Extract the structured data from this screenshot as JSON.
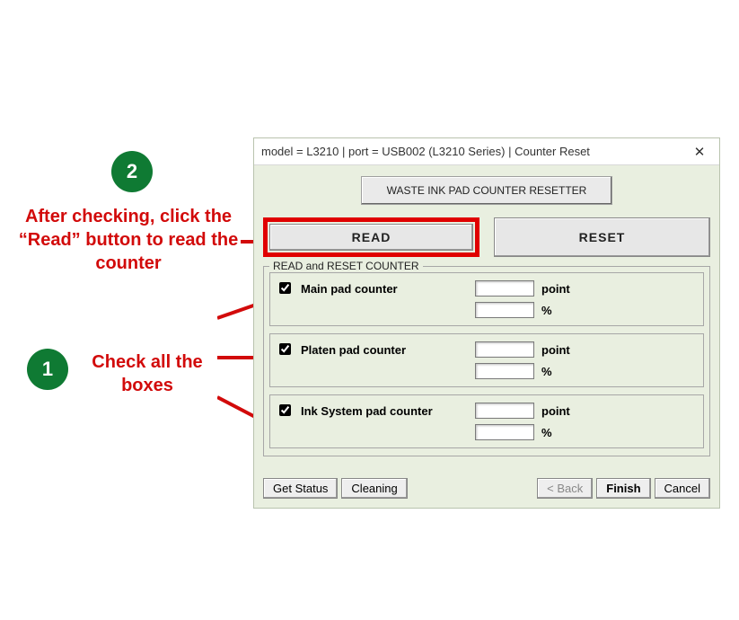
{
  "annotation": {
    "step1_badge": "1",
    "step2_badge": "2",
    "step1_text": "Check all the boxes",
    "step2_text": "After checking, click the “Read” button to read the counter"
  },
  "window": {
    "title": "model = L3210 | port = USB002 (L3210 Series) |   Counter Reset",
    "header_button": "WASTE INK PAD COUNTER RESETTER",
    "read_button": "READ",
    "reset_button": "RESET",
    "group_title": "READ and RESET COUNTER",
    "counters": [
      {
        "label": "Main pad counter",
        "checked": true,
        "point": "",
        "percent": ""
      },
      {
        "label": "Platen pad counter",
        "checked": true,
        "point": "",
        "percent": ""
      },
      {
        "label": "Ink System pad counter",
        "checked": true,
        "point": "",
        "percent": ""
      }
    ],
    "unit_point": "point",
    "unit_percent": "%",
    "footer": {
      "get_status": "Get Status",
      "cleaning": "Cleaning",
      "back": "< Back",
      "finish": "Finish",
      "cancel": "Cancel"
    }
  }
}
